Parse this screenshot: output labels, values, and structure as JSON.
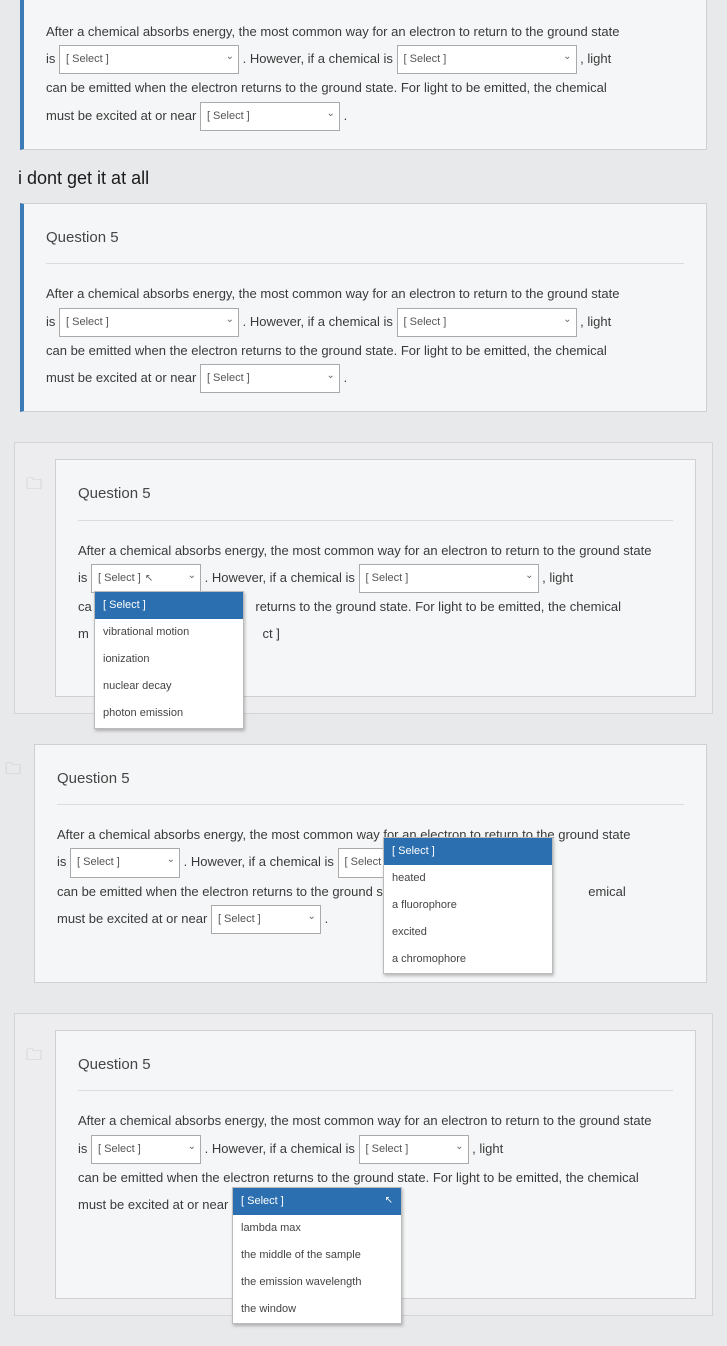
{
  "question_title": "Question 5",
  "body": {
    "p1a": "After a chemical absorbs energy, the most common way for an electron to return to the ground state",
    "p1b": "is",
    "p1c": ".  However, if a chemical is",
    "p1d": ", light",
    "p2a": "can be emitted when the electron returns to the ground state.  For light to be emitted, the chemical",
    "p2b": "must be excited at or near",
    "p2c": ".",
    "alt2a": "returns to the ground state.  For light to be emitted, the chemical",
    "alt2b_prefix": "ca",
    "alt2b_suffix": "m",
    "alt_sel3_frag": "ct ]",
    "alt_emical": "emical"
  },
  "select_placeholder": "[ Select ]",
  "comment": "i dont get it at all",
  "dd1": {
    "opt0": "[ Select ]",
    "opt1": "vibrational motion",
    "opt2": "ionization",
    "opt3": "nuclear decay",
    "opt4": "photon emission"
  },
  "dd2": {
    "opt0": "[ Select ]",
    "opt1": "heated",
    "opt2": "a fluorophore",
    "opt3": "excited",
    "opt4": "a chromophore"
  },
  "dd3": {
    "opt0": "[ Select ]",
    "opt1": "lambda max",
    "opt2": "the middle of the sample",
    "opt3": "the emission wavelength",
    "opt4": "the window"
  }
}
